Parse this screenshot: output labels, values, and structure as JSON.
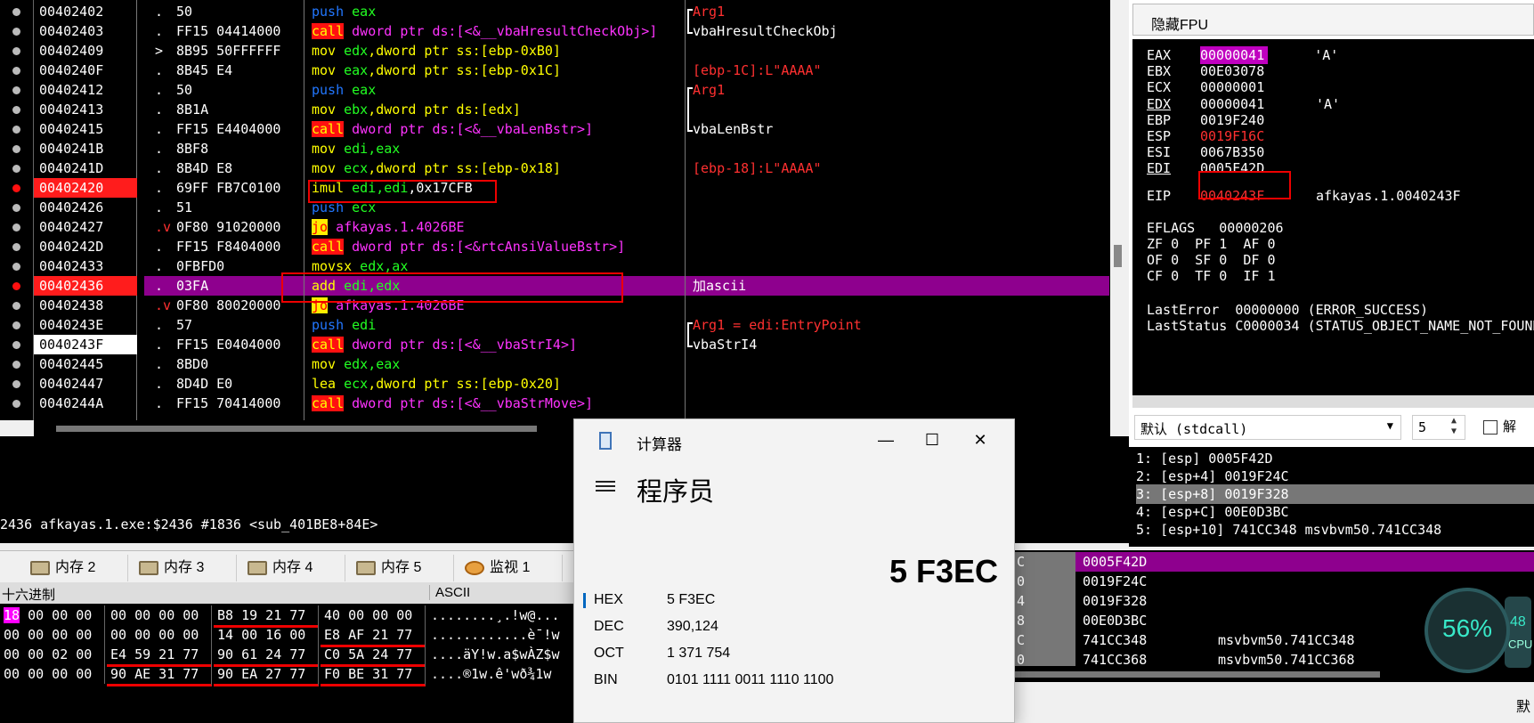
{
  "disassembly": {
    "rows": [
      {
        "addr": "00402402",
        "jump": ".",
        "bytes": "50",
        "insn": [
          [
            "push",
            "kw-push"
          ],
          [
            " eax",
            "kw-reg"
          ]
        ],
        "cmt": [
          [
            "Arg1",
            "red"
          ]
        ]
      },
      {
        "addr": "00402403",
        "jump": ".",
        "bytes": "FF15 04414000",
        "insn": [
          [
            "call",
            "kw-call"
          ],
          [
            " dword ptr ds:[<&__vbaHresultCheckObj>]",
            "kw-brk"
          ]
        ],
        "cmt": [
          [
            "vbaHresultCheckObj",
            ""
          ]
        ]
      },
      {
        "addr": "00402409",
        "jump": ">",
        "bytes": "8B95 50FFFFFF",
        "insn": [
          [
            "mov",
            "kw-mov"
          ],
          [
            " edx",
            "kw-reg"
          ],
          [
            ",dword ptr ss:[ebp-0xB0]",
            "kw-plain"
          ]
        ],
        "cmt": []
      },
      {
        "addr": "0040240F",
        "jump": ".",
        "bytes": "8B45 E4",
        "insn": [
          [
            "mov",
            "kw-mov"
          ],
          [
            " eax",
            "kw-reg"
          ],
          [
            ",dword ptr ss:[ebp-0x1C]",
            "kw-plain"
          ]
        ],
        "cmt": [
          [
            "[ebp-1C]:L\"AAAA\"",
            "red"
          ]
        ]
      },
      {
        "addr": "00402412",
        "jump": ".",
        "bytes": "50",
        "insn": [
          [
            "push",
            "kw-push"
          ],
          [
            " eax",
            "kw-reg"
          ]
        ],
        "cmt": [
          [
            "Arg1",
            "red"
          ]
        ]
      },
      {
        "addr": "00402413",
        "jump": ".",
        "bytes": "8B1A",
        "insn": [
          [
            "mov",
            "kw-mov"
          ],
          [
            " ebx",
            "kw-reg"
          ],
          [
            ",dword ptr ds:[edx]",
            "kw-plain"
          ]
        ],
        "cmt": []
      },
      {
        "addr": "00402415",
        "jump": ".",
        "bytes": "FF15 E4404000",
        "insn": [
          [
            "call",
            "kw-call"
          ],
          [
            " dword ptr ds:[<&__vbaLenBstr>]",
            "kw-brk"
          ]
        ],
        "cmt": [
          [
            "vbaLenBstr",
            ""
          ]
        ]
      },
      {
        "addr": "0040241B",
        "jump": ".",
        "bytes": "8BF8",
        "insn": [
          [
            "mov",
            "kw-mov"
          ],
          [
            " edi",
            "kw-reg"
          ],
          [
            ",eax",
            "kw-reg"
          ]
        ],
        "cmt": []
      },
      {
        "addr": "0040241D",
        "jump": ".",
        "bytes": "8B4D E8",
        "insn": [
          [
            "mov",
            "kw-mov"
          ],
          [
            " ecx",
            "kw-reg"
          ],
          [
            ",dword ptr ss:[ebp-0x18]",
            "kw-plain"
          ]
        ],
        "cmt": [
          [
            "[ebp-18]:L\"AAAA\"",
            "red"
          ]
        ]
      },
      {
        "addr": "00402420",
        "jump": ".",
        "bytes": "69FF FB7C0100",
        "insn": [
          [
            "imul",
            "kw-mov"
          ],
          [
            " edi",
            "kw-reg"
          ],
          [
            ",edi",
            "kw-reg"
          ],
          [
            ",0x17CFB",
            "kw-num"
          ]
        ],
        "cmt": []
      },
      {
        "addr": "00402426",
        "jump": ".",
        "bytes": "51",
        "insn": [
          [
            "push",
            "kw-push"
          ],
          [
            " ecx",
            "kw-reg"
          ]
        ],
        "cmt": []
      },
      {
        "addr": "00402427",
        "jump": ".v",
        "bytes": "0F80 91020000",
        "insn": [
          [
            "jo",
            "kw-jo"
          ],
          [
            " afkayas.1.4026BE",
            "kw-brk"
          ]
        ],
        "cmt": []
      },
      {
        "addr": "0040242D",
        "jump": ".",
        "bytes": "FF15 F8404000",
        "insn": [
          [
            "call",
            "kw-call"
          ],
          [
            " dword ptr ds:[<&rtcAnsiValueBstr>]",
            "kw-brk"
          ]
        ],
        "cmt": []
      },
      {
        "addr": "00402433",
        "jump": ".",
        "bytes": "0FBFD0",
        "insn": [
          [
            "movsx",
            "kw-mov"
          ],
          [
            " edx",
            "kw-reg"
          ],
          [
            ",ax",
            "kw-reg"
          ]
        ],
        "cmt": []
      },
      {
        "addr": "00402436",
        "jump": ".",
        "bytes": "03FA",
        "insn": [
          [
            "add",
            "kw-mov"
          ],
          [
            " edi",
            "kw-reg"
          ],
          [
            ",edx",
            "kw-reg"
          ]
        ],
        "cmt": [
          [
            "加ascii",
            ""
          ]
        ]
      },
      {
        "addr": "00402438",
        "jump": ".v",
        "bytes": "0F80 80020000",
        "insn": [
          [
            "jo",
            "kw-jo"
          ],
          [
            " afkayas.1.4026BE",
            "kw-brk"
          ]
        ],
        "cmt": []
      },
      {
        "addr": "0040243E",
        "jump": ".",
        "bytes": "57",
        "insn": [
          [
            "push",
            "kw-push"
          ],
          [
            " edi",
            "kw-reg"
          ]
        ],
        "cmt": [
          [
            "Arg1 = edi:EntryPoint",
            "red"
          ]
        ]
      },
      {
        "addr": "0040243F",
        "jump": ".",
        "bytes": "FF15 E0404000",
        "insn": [
          [
            "call",
            "kw-call"
          ],
          [
            " dword ptr ds:[<&__vbaStrI4>]",
            "kw-brk"
          ]
        ],
        "cmt": [
          [
            "vbaStrI4",
            ""
          ]
        ]
      },
      {
        "addr": "00402445",
        "jump": ".",
        "bytes": "8BD0",
        "insn": [
          [
            "mov",
            "kw-mov"
          ],
          [
            " edx",
            "kw-reg"
          ],
          [
            ",eax",
            "kw-reg"
          ]
        ],
        "cmt": []
      },
      {
        "addr": "00402447",
        "jump": ".",
        "bytes": "8D4D E0",
        "insn": [
          [
            "lea",
            "kw-lea"
          ],
          [
            " ecx",
            "kw-reg"
          ],
          [
            ",dword ptr ss:[ebp-0x20]",
            "kw-plain"
          ]
        ],
        "cmt": []
      },
      {
        "addr": "0040244A",
        "jump": ".",
        "bytes": "FF15 70414000",
        "insn": [
          [
            "call",
            "kw-call"
          ],
          [
            " dword ptr ds:[<&__vbaStrMove>]",
            "kw-brk"
          ]
        ],
        "cmt": []
      }
    ]
  },
  "info_line": "2436 afkayas.1.exe:$2436 #1836 <sub_401BE8+84E>",
  "registers": {
    "header": "隐藏FPU",
    "rows": [
      {
        "n": "EAX",
        "v": "00000041",
        "c": "'A'",
        "style": "mag"
      },
      {
        "n": "EBX",
        "v": "00E03078",
        "c": ""
      },
      {
        "n": "ECX",
        "v": "00000001",
        "c": ""
      },
      {
        "n": "EDX",
        "v": "00000041",
        "c": "'A'",
        "u": true
      },
      {
        "n": "EBP",
        "v": "0019F240",
        "c": ""
      },
      {
        "n": "ESP",
        "v": "0019F16C",
        "c": "",
        "style": "red"
      },
      {
        "n": "ESI",
        "v": "0067B350",
        "c": ""
      },
      {
        "n": "EDI",
        "v": "0005F42D",
        "c": "",
        "u": true
      }
    ],
    "eip": {
      "n": "EIP",
      "v": "0040243F",
      "c": "afkayas.1.0040243F"
    },
    "eflags": "EFLAGS   00000206",
    "flags": [
      "ZF 0  PF 1  AF 0",
      "OF 0  SF 0  DF 0",
      "CF 0  TF 0  IF 1"
    ],
    "last_error": "LastError  00000000 (ERROR_SUCCESS)",
    "last_status": "LastStatus C0000034 (STATUS_OBJECT_NAME_NOT_FOUND)"
  },
  "callconv": {
    "value": "默认 (stdcall)",
    "count": "5",
    "check_label": "解"
  },
  "stack_args": [
    "1: [esp] 0005F42D",
    "2: [esp+4] 0019F24C",
    "3: [esp+8] 0019F328",
    "4: [esp+C] 00E0D3BC",
    "5: [esp+10] 741CC348 msvbvm50.741CC348"
  ],
  "tabs": [
    "内存 2",
    "内存 3",
    "内存 4",
    "内存 5",
    "监视 1"
  ],
  "dump": {
    "hdr_hex": "十六进制",
    "hdr_ascii": "ASCII",
    "rows": [
      {
        "g": [
          "18 00 00 00",
          "00 00 00 00",
          "B8 19 21 77",
          "40 00 00 00"
        ],
        "asc": "........¸.!w@..."
      },
      {
        "g": [
          "00 00 00 00",
          "00 00 00 00",
          "14 00 16 00",
          "E8 AF 21 77"
        ],
        "asc": "............è¯!w"
      },
      {
        "g": [
          "00 00 02 00",
          "E4 59 21 77",
          "90 61 24 77",
          "C0 5A 24 77"
        ],
        "asc": "....äY!w.a$wÀZ$w"
      },
      {
        "g": [
          "00 00 00 00",
          "90 AE 31 77",
          "90 EA 27 77",
          "F0 BE 31 77"
        ],
        "asc": "....®1w.ê'wð¾1w"
      }
    ]
  },
  "stack": [
    {
      "a": "C",
      "v": "0005F42D",
      "c": ""
    },
    {
      "a": "0",
      "v": "0019F24C",
      "c": ""
    },
    {
      "a": "4",
      "v": "0019F328",
      "c": ""
    },
    {
      "a": "8",
      "v": "00E0D3BC",
      "c": ""
    },
    {
      "a": "C",
      "v": "741CC348",
      "c": "msvbvm50.741CC348"
    },
    {
      "a": "0",
      "v": "741CC368",
      "c": "msvbvm50.741CC368"
    }
  ],
  "bottom_right_text": "默",
  "cpu_widget": {
    "percent": "56%",
    "side_value": "48",
    "side_label": "CPU"
  },
  "calculator": {
    "title": "计算器",
    "mode": "程序员",
    "result": "5 F3EC",
    "rows": [
      {
        "lbl": "HEX",
        "val": "5 F3EC",
        "active": true
      },
      {
        "lbl": "DEC",
        "val": "390,124"
      },
      {
        "lbl": "OCT",
        "val": "1 371 754"
      },
      {
        "lbl": "BIN",
        "val": "0101 1111 0011 1110 1100"
      }
    ],
    "min_glyph": "—",
    "max_glyph": "☐",
    "close_glyph": "✕"
  },
  "colors": {
    "breakpoint": "#ff1c1c",
    "highlight": "#8e008e",
    "annotation_box": "#e00000",
    "calc_accent": "#0067c0"
  }
}
